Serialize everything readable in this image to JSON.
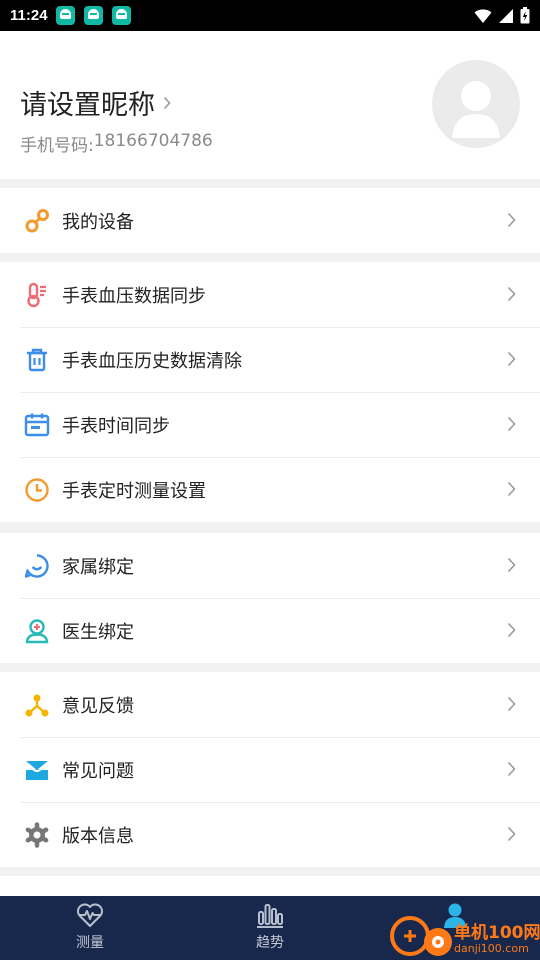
{
  "status_bar": {
    "time": "11:24"
  },
  "profile": {
    "nickname": "请设置昵称",
    "phone_label": "手机号码:",
    "phone": "18166704786"
  },
  "menu": {
    "device": "我的设备",
    "bp_sync": "手表血压数据同步",
    "bp_clear": "手表血压历史数据清除",
    "time_sync": "手表时间同步",
    "timed_measure": "手表定时测量设置",
    "family_bind": "家属绑定",
    "doctor_bind": "医生绑定",
    "feedback": "意见反馈",
    "faq": "常见问题",
    "version": "版本信息"
  },
  "tabs": {
    "measure": "测量",
    "trend": "趋势"
  },
  "watermark": {
    "name": "单机100网",
    "url": "danji100.com"
  },
  "colors": {
    "accent_orange": "#f39a2e",
    "accent_blue": "#3d8ee8",
    "accent_teal": "#27b8b8",
    "tabbar": "#18284d"
  }
}
